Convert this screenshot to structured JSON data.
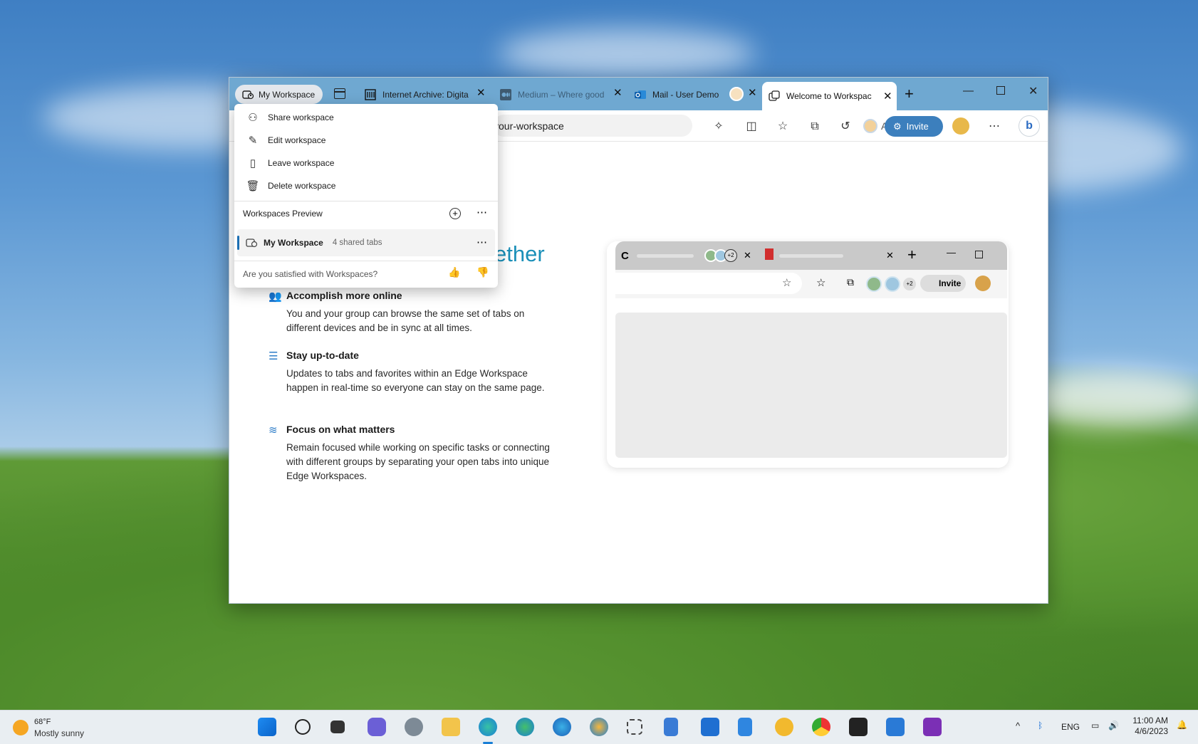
{
  "browser": {
    "workspace_pill": "My Workspace",
    "tabs": [
      {
        "title": "Internet Archive: Digita"
      },
      {
        "title": "Medium – Where good"
      },
      {
        "title": "Mail - User Demo"
      }
    ],
    "active_tab": "Welcome to Workspac",
    "address": "your-workspace",
    "invite_label": "Invite"
  },
  "menu": {
    "items": [
      {
        "label": "Share workspace",
        "icon": "share-icon"
      },
      {
        "label": "Edit workspace",
        "icon": "pencil-icon"
      },
      {
        "label": "Leave workspace",
        "icon": "leave-icon"
      },
      {
        "label": "Delete workspace",
        "icon": "trash-icon"
      }
    ],
    "section_title": "Workspaces Preview",
    "workspace_name": "My Workspace",
    "workspace_tabs": "4 shared tabs",
    "feedback": "Are you satisfied with Workspaces?"
  },
  "page": {
    "title_fragment": "ether",
    "features": [
      {
        "title": "Accomplish more online",
        "text": "You and your group can browse the same set of tabs on different devices and be in sync at all times."
      },
      {
        "title": "Stay up-to-date",
        "text": "Updates to tabs and favorites within an Edge Workspace happen in real-time so everyone can stay on the same page."
      },
      {
        "title": "Focus on what matters",
        "text": "Remain focused while working on specific tasks or connecting with different groups by separating your open tabs into unique Edge Workspaces."
      }
    ],
    "mock": {
      "tab_letter": "C",
      "badge": "+2",
      "invite": "Invite"
    }
  },
  "taskbar": {
    "temp": "68°F",
    "weather": "Mostly sunny",
    "lang": "ENG",
    "time": "11:00 AM",
    "date": "4/6/2023"
  },
  "colors": {
    "accent": "#3c7fbd",
    "tabstrip": "#6fa8d1",
    "title": "#1a8fb8"
  }
}
